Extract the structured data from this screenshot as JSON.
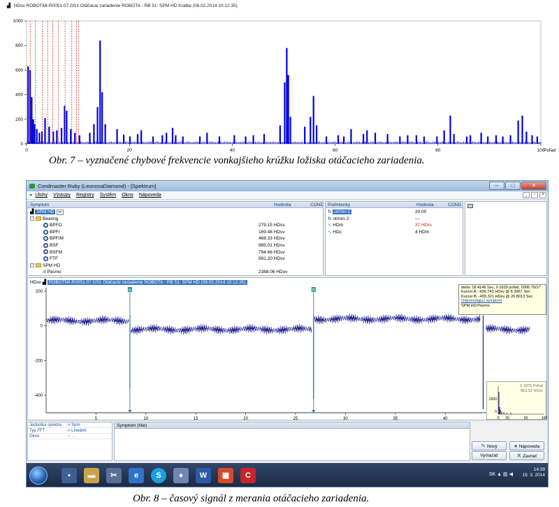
{
  "fig7": {
    "header": "HDsv  ROBOTMI-R0051.07.GS1 Otáčacie zariadenie ROBOTA - RB 51: SPM HD Krátke (08.02.2014 10:12:35)",
    "x_unit_label": "Poľad",
    "caption": "Obr. 7 – vyznačené chybové frekvencie vonkajšieho krúžku ložiska otáčacieho zariadenia."
  },
  "chart_data": [
    {
      "type": "bar",
      "ylabel": "HDsv",
      "xlabel": "Poľad",
      "xlim": [
        0,
        100
      ],
      "ylim": [
        0,
        1000
      ],
      "x_ticks": [
        0,
        20,
        40,
        60,
        80,
        100
      ],
      "y_ticks": [
        0,
        200,
        400,
        600,
        800,
        1000
      ],
      "marker_lines_x": [
        0.7,
        1.7,
        3.1,
        4.1,
        5.1,
        6.2,
        7.5,
        8.8,
        9.7,
        10.1
      ],
      "peaks": [
        {
          "x": 0.3,
          "y": 630
        },
        {
          "x": 0.7,
          "y": 600
        },
        {
          "x": 1.0,
          "y": 380
        },
        {
          "x": 1.3,
          "y": 200
        },
        {
          "x": 1.6,
          "y": 160
        },
        {
          "x": 2.0,
          "y": 120
        },
        {
          "x": 2.5,
          "y": 90
        },
        {
          "x": 3.0,
          "y": 100
        },
        {
          "x": 3.6,
          "y": 210
        },
        {
          "x": 4.4,
          "y": 140
        },
        {
          "x": 5.2,
          "y": 100
        },
        {
          "x": 5.9,
          "y": 110
        },
        {
          "x": 6.8,
          "y": 130
        },
        {
          "x": 7.4,
          "y": 310
        },
        {
          "x": 7.8,
          "y": 270
        },
        {
          "x": 8.6,
          "y": 120
        },
        {
          "x": 9.4,
          "y": 90
        },
        {
          "x": 10.3,
          "y": 70
        },
        {
          "x": 12.3,
          "y": 90
        },
        {
          "x": 13.1,
          "y": 160
        },
        {
          "x": 13.8,
          "y": 300
        },
        {
          "x": 14.3,
          "y": 840
        },
        {
          "x": 14.7,
          "y": 420
        },
        {
          "x": 15.3,
          "y": 160
        },
        {
          "x": 17.6,
          "y": 120
        },
        {
          "x": 18.9,
          "y": 75
        },
        {
          "x": 20.1,
          "y": 60
        },
        {
          "x": 21.6,
          "y": 80
        },
        {
          "x": 22.3,
          "y": 110
        },
        {
          "x": 24.6,
          "y": 60
        },
        {
          "x": 26.4,
          "y": 70
        },
        {
          "x": 27.2,
          "y": 90
        },
        {
          "x": 28.4,
          "y": 130
        },
        {
          "x": 29.0,
          "y": 70
        },
        {
          "x": 30.4,
          "y": 60
        },
        {
          "x": 33.7,
          "y": 60
        },
        {
          "x": 35.1,
          "y": 90
        },
        {
          "x": 37.5,
          "y": 60
        },
        {
          "x": 40.4,
          "y": 70
        },
        {
          "x": 42.6,
          "y": 60
        },
        {
          "x": 44.1,
          "y": 70
        },
        {
          "x": 46.2,
          "y": 80
        },
        {
          "x": 49.3,
          "y": 150
        },
        {
          "x": 50.2,
          "y": 500
        },
        {
          "x": 50.6,
          "y": 780
        },
        {
          "x": 50.9,
          "y": 560
        },
        {
          "x": 51.3,
          "y": 220
        },
        {
          "x": 54.1,
          "y": 140
        },
        {
          "x": 55.2,
          "y": 220
        },
        {
          "x": 55.8,
          "y": 390
        },
        {
          "x": 56.4,
          "y": 150
        },
        {
          "x": 58.3,
          "y": 60
        },
        {
          "x": 60.6,
          "y": 70
        },
        {
          "x": 61.7,
          "y": 60
        },
        {
          "x": 63.1,
          "y": 120
        },
        {
          "x": 65.5,
          "y": 80
        },
        {
          "x": 66.2,
          "y": 110
        },
        {
          "x": 67.8,
          "y": 90
        },
        {
          "x": 70.2,
          "y": 80
        },
        {
          "x": 72.6,
          "y": 60
        },
        {
          "x": 74.1,
          "y": 70
        },
        {
          "x": 75.8,
          "y": 70
        },
        {
          "x": 77.3,
          "y": 60
        },
        {
          "x": 79.8,
          "y": 60
        },
        {
          "x": 81.2,
          "y": 110
        },
        {
          "x": 82.4,
          "y": 230
        },
        {
          "x": 83.1,
          "y": 80
        },
        {
          "x": 85.6,
          "y": 60
        },
        {
          "x": 86.3,
          "y": 70
        },
        {
          "x": 88.4,
          "y": 90
        },
        {
          "x": 89.7,
          "y": 60
        },
        {
          "x": 91.3,
          "y": 70
        },
        {
          "x": 92.6,
          "y": 60
        },
        {
          "x": 94.1,
          "y": 70
        },
        {
          "x": 95.6,
          "y": 190
        },
        {
          "x": 96.4,
          "y": 230
        },
        {
          "x": 97.2,
          "y": 100
        },
        {
          "x": 98.3,
          "y": 70
        },
        {
          "x": 99.3,
          "y": 60
        }
      ]
    },
    {
      "type": "line",
      "ylabel": "HDsv",
      "xlim": [
        0,
        50
      ],
      "ylim": [
        -500,
        220
      ],
      "x_ticks": [
        5,
        10,
        15,
        20,
        25,
        30,
        35,
        40
      ],
      "y_ticks": [
        200,
        0,
        -200,
        -400
      ],
      "cursor_a_x": 8.3967,
      "cursor_b_x": 26.8013,
      "segments": [
        {
          "x0": 0,
          "x1": 8.3,
          "level": 30
        },
        {
          "x0": 8.5,
          "x1": 26.6,
          "level": -20
        },
        {
          "x0": 26.9,
          "x1": 43.5,
          "level": 40
        },
        {
          "x0": 44.1,
          "x1": 48.5,
          "level": -20
        }
      ],
      "spikes": [
        {
          "x": 8.4,
          "y": -360
        },
        {
          "x": 26.8,
          "y": -420
        },
        {
          "x": 43.8,
          "y": -480
        }
      ]
    }
  ],
  "win": {
    "title": "Condmaster Ruby (LeonovaDiamond) - [Spektrum]",
    "menu": [
      "Úlohy",
      "Výstupy",
      "Registry",
      "Systém",
      "Okno",
      "Nápoveda"
    ],
    "sym_panel": {
      "col1": "Symptom",
      "col2": "Hodnota",
      "col3": "COND",
      "root": "SPM HD",
      "group": "Bearing",
      "items": [
        {
          "name": "BPFO",
          "value": "279.15 HDsv"
        },
        {
          "name": "BPFI",
          "value": "169.48 HDsv"
        },
        {
          "name": "BPFIM",
          "value": "468.33 HDsv"
        },
        {
          "name": "BSF",
          "value": "985.01 HDsv"
        },
        {
          "name": "BSFM",
          "value": "794.66 HDsv"
        },
        {
          "name": "FTF",
          "value": "891.20 HDsv"
        }
      ],
      "group2": "SPM HD",
      "band": {
        "name": "Pásmo",
        "value": "2388.06 HDsv"
      }
    },
    "cond_panel": {
      "col1": "Podmienky",
      "col2": "Hodnota",
      "col3": "COND",
      "rows": [
        {
          "name": "ot/min 1",
          "value": "20.00",
          "color": "#000"
        },
        {
          "name": "ot/min 2",
          "value": "---",
          "color": "#000"
        },
        {
          "name": "HDm",
          "value": "37 HDm",
          "color": "#cc2200"
        },
        {
          "name": "HDc",
          "value": "4 HDm",
          "color": "#000"
        }
      ]
    },
    "signal_header_prefix": "HDsv",
    "signal_header": "ROBOTMI-R0051.07.GS1 Otáčacie zariadenie ROBOTA - RB 51: SPM HD (08.02.2014 10:12:35)",
    "cursor_box": [
      "delta: 18.4146 Sec, 0.1629 poľad, 2006.79/1/\"",
      "Kurzor A: -436.743 HDsv @ 8.3967 Sec",
      "Kurzor B: -455.321 HDsv @ 26.8013 Sec",
      "Odpovedajúci symptom",
      "SPM HD:Pásmo"
    ],
    "cursor_a": "A",
    "cursor_b": "B",
    "inset": {
      "line1": "0.1875 Poľad",
      "line2": "863.52 HDsv",
      "y_tick": "2000",
      "y_zero": "0",
      "x_ticks": [
        "0",
        "20",
        "60",
        "100"
      ]
    },
    "props": [
      {
        "k": "Jednotka spektra",
        "v": "-> Spm",
        "disabled": false
      },
      {
        "k": "Typ FFT",
        "v": "-> Lineární",
        "disabled": false
      },
      {
        "k": "Okno",
        "v": "-> ...",
        "disabled": true
      }
    ],
    "symptom_header": "Symptom (Nie)",
    "buttons": {
      "new": "Nový",
      "help": "Nápoveda",
      "delete": "Vymazať",
      "close": "Zavrieť"
    },
    "tray": {
      "time": "14:39",
      "date": "19. 3. 2014",
      "lang": "SK"
    }
  },
  "fig8": {
    "caption": "Obr. 8 – časový signál z merania otáčacieho zariadenia."
  },
  "colors": {
    "signal": "#1c1c8c",
    "marker": "#d03020",
    "cursor": "#2a9a9a",
    "bar": "#0000e0"
  }
}
